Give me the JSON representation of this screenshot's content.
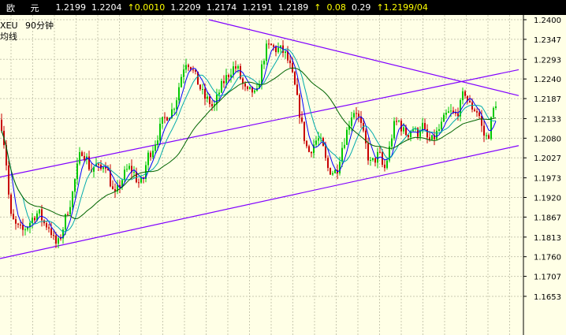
{
  "header": {
    "name": "欧 元",
    "values": [
      "1.2199",
      "1.2204"
    ],
    "change": "↑0.0010",
    "values2": [
      "1.2209",
      "1.2174",
      "1.2191",
      "1.2189"
    ],
    "arrow": "↑",
    "vol": "0.08",
    "amp": "0.29",
    "last": "↑1.2199/04"
  },
  "legend": {
    "symbol": "XEU",
    "period": "90分钟",
    "indicator": "均线"
  },
  "colors": {
    "background": "#ffffe6",
    "grid": "#c8c8b0",
    "up": "#00c800",
    "down": "#c80000",
    "ma_short": "#0000ff",
    "ma_mid": "#00aaaa",
    "ma_long": "#006400",
    "trendline": "#8000ff"
  },
  "chart_data": {
    "type": "candlestick",
    "ylim": [
      1.16,
      1.244
    ],
    "yticks": [
      "1.2400",
      "1.2347",
      "1.2293",
      "1.2240",
      "1.2187",
      "1.2133",
      "1.2080",
      "1.2027",
      "1.1973",
      "1.1920",
      "1.1867",
      "1.1813",
      "1.1760",
      "1.1707",
      "1.1653"
    ],
    "price_path": [
      [
        0,
        1.213
      ],
      [
        6,
        1.204
      ],
      [
        12,
        1.187
      ],
      [
        20,
        1.184
      ],
      [
        28,
        1.183
      ],
      [
        36,
        1.185
      ],
      [
        42,
        1.187
      ],
      [
        48,
        1.188
      ],
      [
        55,
        1.185
      ],
      [
        62,
        1.184
      ],
      [
        68,
        1.18
      ],
      [
        72,
        1.179
      ],
      [
        78,
        1.183
      ],
      [
        84,
        1.188
      ],
      [
        90,
        1.192
      ],
      [
        96,
        1.199
      ],
      [
        102,
        1.205
      ],
      [
        108,
        1.203
      ],
      [
        114,
        1.199
      ],
      [
        120,
        1.201
      ],
      [
        126,
        1.199
      ],
      [
        132,
        1.202
      ],
      [
        138,
        1.197
      ],
      [
        144,
        1.192
      ],
      [
        150,
        1.195
      ],
      [
        156,
        1.198
      ],
      [
        162,
        1.2
      ],
      [
        168,
        1.199
      ],
      [
        174,
        1.196
      ],
      [
        180,
        1.196
      ],
      [
        186,
        1.203
      ],
      [
        192,
        1.205
      ],
      [
        198,
        1.208
      ],
      [
        204,
        1.212
      ],
      [
        210,
        1.214
      ],
      [
        216,
        1.215
      ],
      [
        222,
        1.218
      ],
      [
        228,
        1.224
      ],
      [
        234,
        1.229
      ],
      [
        240,
        1.228
      ],
      [
        246,
        1.225
      ],
      [
        252,
        1.222
      ],
      [
        258,
        1.219
      ],
      [
        264,
        1.218
      ],
      [
        270,
        1.216
      ],
      [
        276,
        1.22
      ],
      [
        282,
        1.223
      ],
      [
        288,
        1.225
      ],
      [
        294,
        1.227
      ],
      [
        300,
        1.227
      ],
      [
        306,
        1.223
      ],
      [
        312,
        1.22
      ],
      [
        318,
        1.221
      ],
      [
        324,
        1.219
      ],
      [
        330,
        1.226
      ],
      [
        336,
        1.232
      ],
      [
        342,
        1.233
      ],
      [
        348,
        1.232
      ],
      [
        354,
        1.232
      ],
      [
        360,
        1.231
      ],
      [
        366,
        1.228
      ],
      [
        372,
        1.223
      ],
      [
        378,
        1.216
      ],
      [
        384,
        1.209
      ],
      [
        390,
        1.204
      ],
      [
        396,
        1.206
      ],
      [
        402,
        1.208
      ],
      [
        408,
        1.206
      ],
      [
        414,
        1.2
      ],
      [
        420,
        1.199
      ],
      [
        426,
        1.199
      ],
      [
        432,
        1.205
      ],
      [
        438,
        1.209
      ],
      [
        444,
        1.214
      ],
      [
        450,
        1.216
      ],
      [
        456,
        1.212
      ],
      [
        462,
        1.207
      ],
      [
        468,
        1.201
      ],
      [
        474,
        1.202
      ],
      [
        480,
        1.204
      ],
      [
        486,
        1.199
      ],
      [
        492,
        1.204
      ],
      [
        498,
        1.211
      ],
      [
        504,
        1.213
      ],
      [
        510,
        1.21
      ],
      [
        516,
        1.209
      ],
      [
        522,
        1.211
      ],
      [
        528,
        1.209
      ],
      [
        534,
        1.212
      ],
      [
        540,
        1.208
      ],
      [
        546,
        1.207
      ],
      [
        552,
        1.209
      ],
      [
        558,
        1.211
      ],
      [
        564,
        1.214
      ],
      [
        570,
        1.215
      ],
      [
        576,
        1.214
      ],
      [
        582,
        1.216
      ],
      [
        588,
        1.221
      ],
      [
        594,
        1.217
      ],
      [
        600,
        1.216
      ],
      [
        606,
        1.215
      ],
      [
        612,
        1.209
      ],
      [
        618,
        1.208
      ],
      [
        624,
        1.215
      ],
      [
        630,
        1.219
      ]
    ],
    "trendlines": [
      {
        "x1": 0,
        "y1": 1.1975,
        "x2": 658,
        "y2": 1.2265
      },
      {
        "x1": 0,
        "y1": 1.1755,
        "x2": 658,
        "y2": 1.206
      },
      {
        "x1": 265,
        "y1": 1.24,
        "x2": 658,
        "y2": 1.2195
      }
    ]
  }
}
